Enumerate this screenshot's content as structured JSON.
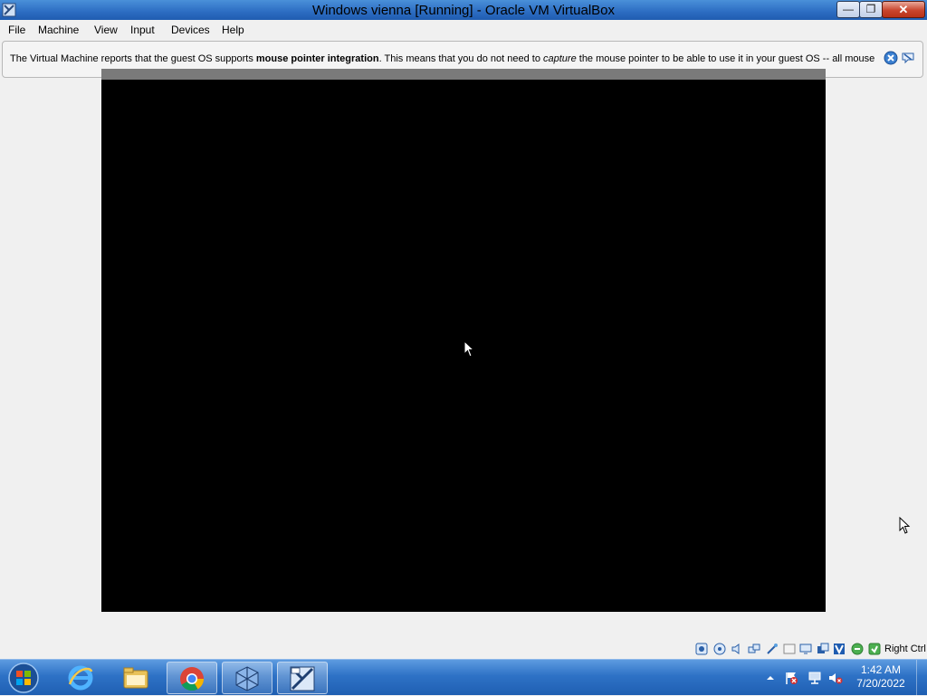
{
  "window": {
    "title": "Windows vienna [Running] - Oracle VM VirtualBox",
    "buttons": {
      "minimize": "—",
      "maximize": "❐",
      "close": "✕"
    }
  },
  "menu": [
    "File",
    "Machine",
    "View",
    "Input",
    "Devices",
    "Help"
  ],
  "notification": {
    "part1": "The Virtual Machine reports that the guest OS supports ",
    "bold": "mouse pointer integration",
    "part2": ". This means that you do not need to ",
    "italic": "capture",
    "part3": " the mouse pointer to be able to use it in your guest OS -- all mouse"
  },
  "statusbar": {
    "icons": [
      "hard-disk-icon",
      "optical-drive-icon",
      "audio-icon",
      "network-icon",
      "usb-icon",
      "shared-folders-icon",
      "display-icon",
      "video-capture-icon",
      "virtualization-icon",
      "mouse-integration-icon",
      "keyboard-icon"
    ],
    "host_key": "Right Ctrl"
  },
  "taskbar": {
    "apps": [
      "internet-explorer",
      "file-explorer",
      "chrome",
      "virtualbox-manager",
      "virtualbox-vm"
    ],
    "active_app": "virtualbox-vm",
    "tray_icons": [
      "show-hidden-icons",
      "action-center-flag-icon",
      "network-icon",
      "volume-muted-icon"
    ],
    "time": "1:42 AM",
    "date": "7/20/2022"
  }
}
